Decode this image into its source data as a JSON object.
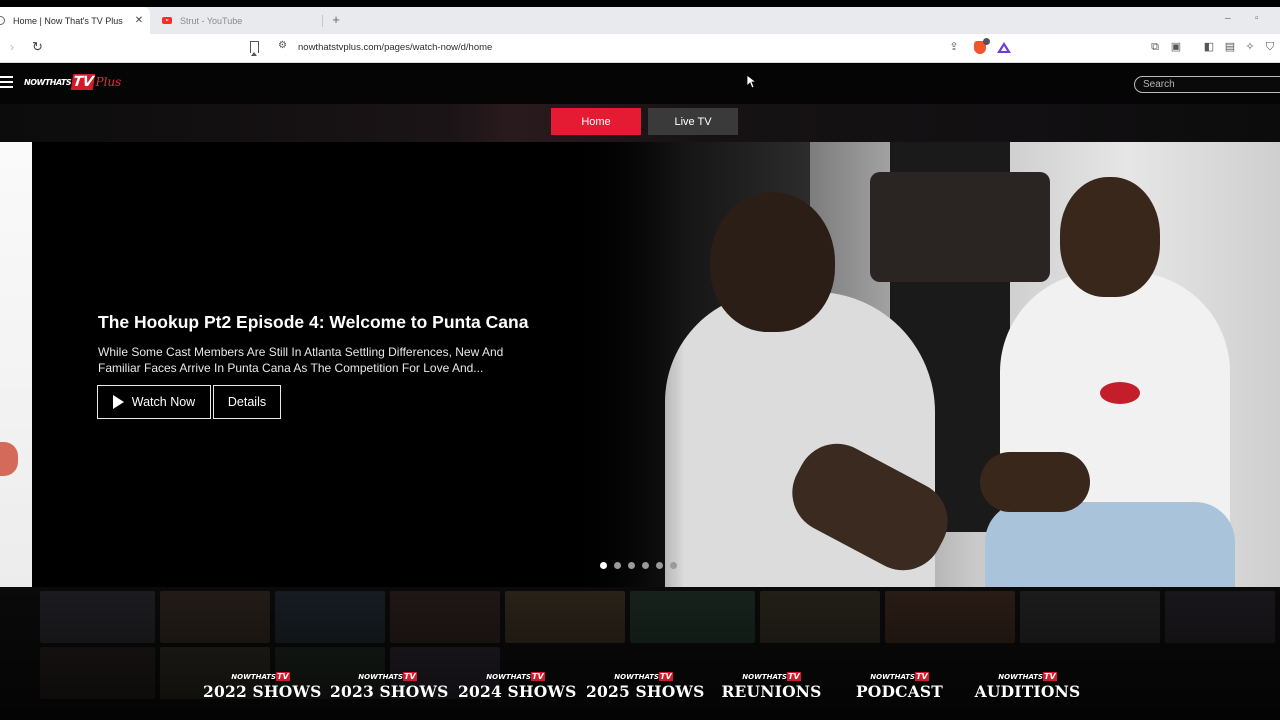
{
  "browser": {
    "tabs": [
      {
        "title": "Home | Now That's TV Plus",
        "active": true
      },
      {
        "title": "Strut - YouTube",
        "active": false
      }
    ],
    "new_tab_label": "+",
    "url": "nowthatstvplus.com/pages/watch-now/d/home",
    "brave_badge_count": "4"
  },
  "site": {
    "logo": {
      "part1": "NOWTHATS",
      "part2": "TV",
      "part3": "Plus"
    },
    "search_placeholder": "Search",
    "nav_tabs": [
      {
        "label": "Home",
        "active": true
      },
      {
        "label": "Live TV",
        "active": false
      }
    ]
  },
  "hero": {
    "title": "The Hookup Pt2 Episode 4: Welcome to Punta Cana",
    "description": "While Some Cast Members Are Still In Atlanta Settling Differences, New And Familiar Faces Arrive In Punta Cana As The Competition For Love And...",
    "watch_label": "Watch Now",
    "details_label": "Details",
    "slide_count": 6,
    "active_slide": 1
  },
  "categories": [
    {
      "badge": "NOWTHATS TV",
      "label": "2022 SHOWS"
    },
    {
      "badge": "NOWTHATS TV",
      "label": "2023 SHOWS"
    },
    {
      "badge": "NOWTHATS TV",
      "label": "2024 SHOWS"
    },
    {
      "badge": "NOWTHATS TV",
      "label": "2025 SHOWS"
    },
    {
      "badge": "NOWTHATS TV",
      "label": "REUNIONS"
    },
    {
      "badge": "NOWTHATS TV",
      "label": "PODCAST"
    },
    {
      "badge": "NOWTHATS TV",
      "label": "AUDITIONS"
    }
  ],
  "colors": {
    "accent": "#e51b33",
    "secondary_tab": "#3a3a3a",
    "background": "#000000"
  }
}
